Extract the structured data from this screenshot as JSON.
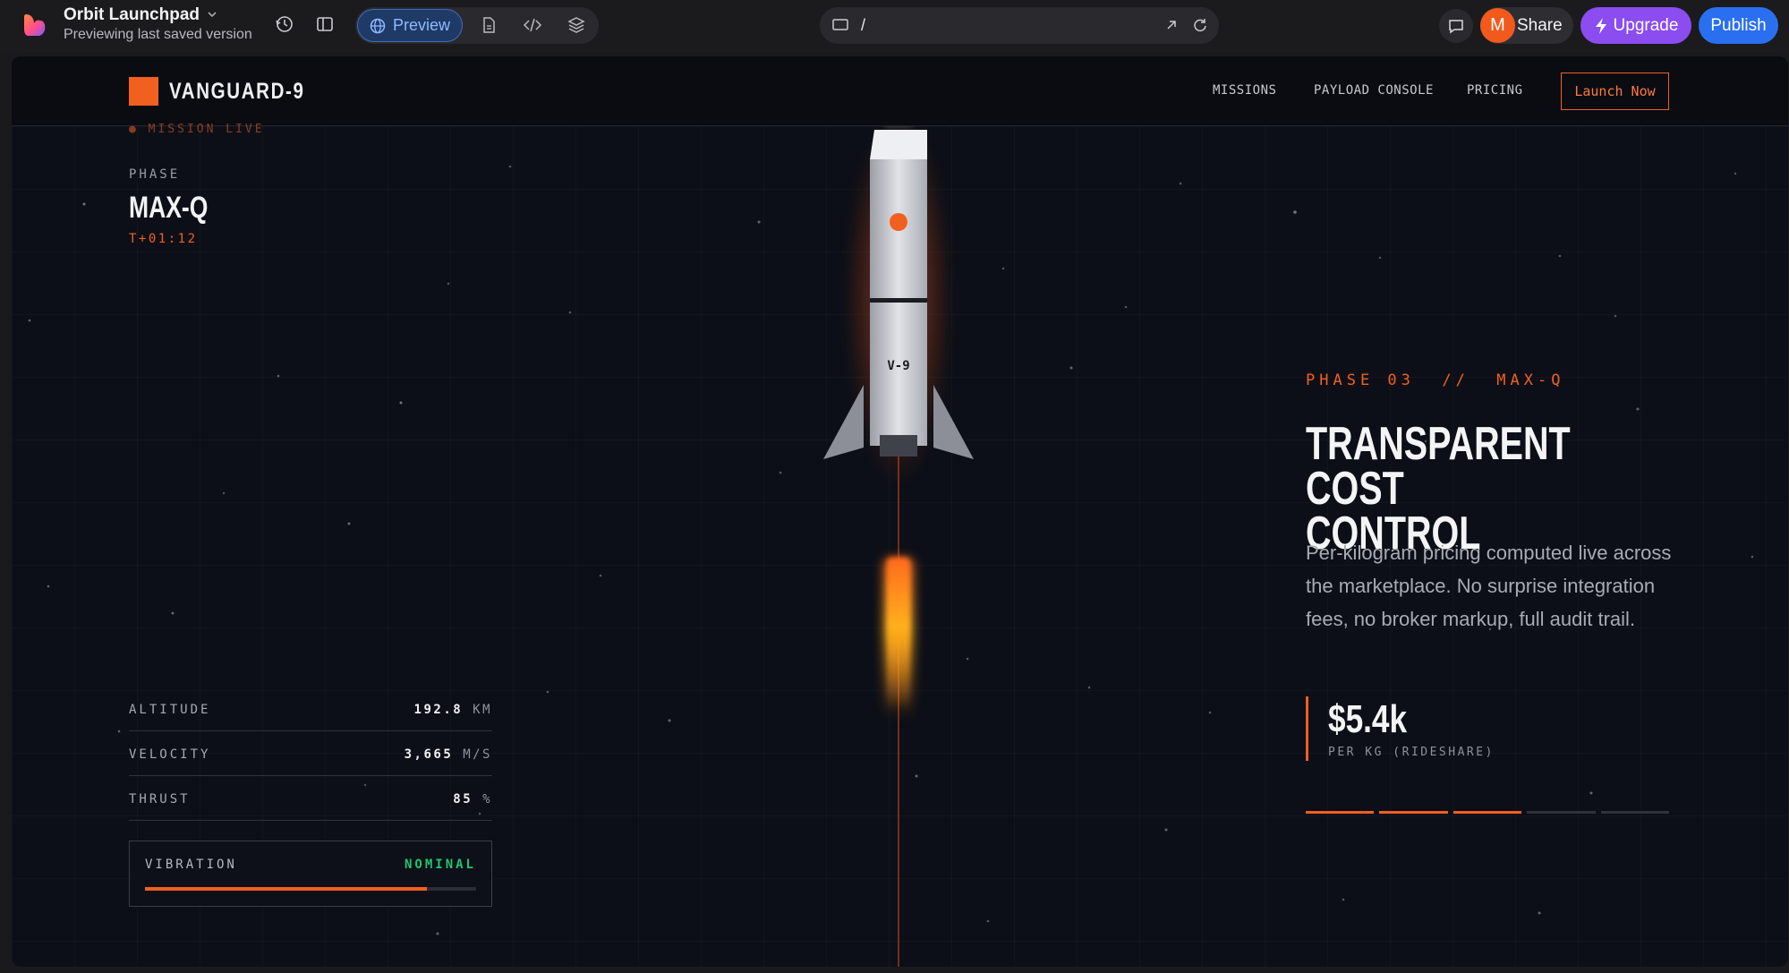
{
  "editor": {
    "app_name": "Orbit Launchpad",
    "app_subtitle": "Previewing last saved version",
    "preview_label": "Preview",
    "url_path": "/",
    "avatar_initial": "M",
    "share_label": "Share",
    "upgrade_label": "Upgrade",
    "publish_label": "Publish",
    "colors": {
      "preview_accent": "#8fbaff",
      "upgrade": "#8b4cf0",
      "publish": "#2a6ff0",
      "avatar": "#f25a1d"
    },
    "icons": [
      "app-logo-icon",
      "chevron-down-icon",
      "history-icon",
      "sidebar-toggle-icon",
      "globe-icon",
      "file-icon",
      "code-icon",
      "layers-icon",
      "monitor-icon",
      "open-external-icon",
      "refresh-icon",
      "chat-icon",
      "lightning-icon"
    ]
  },
  "site": {
    "brand": "VANGUARD-9",
    "nav": [
      "MISSIONS",
      "PAYLOAD CONSOLE",
      "PRICING"
    ],
    "cta": "Launch Now",
    "accent_color": "#f2601f",
    "status_line": "● MISSION LIVE",
    "phase_label": "PHASE",
    "phase_value": "MAX-Q",
    "phase_time": "T+01:12",
    "rocket_label": "V-9",
    "telemetry": [
      {
        "label": "ALTITUDE",
        "value": "192.8",
        "unit": "KM"
      },
      {
        "label": "VELOCITY",
        "value": "3,665",
        "unit": "M/S"
      },
      {
        "label": "THRUST",
        "value": "85",
        "unit": "%"
      }
    ],
    "vibration": {
      "label": "VIBRATION",
      "status": "NOMINAL",
      "level": 0.85,
      "status_color": "#1fc46d"
    },
    "feature": {
      "phase_heading": "PHASE 03  //  MAX-Q",
      "headline_line1": "TRANSPARENT COST",
      "headline_line2": "CONTROL",
      "body": "Per-kilogram pricing computed live across the marketplace. No surprise integration fees, no broker markup, full audit trail.",
      "price": "$5.4k",
      "price_unit": "PER KG (RIDESHARE)",
      "progress_total": 5,
      "progress_active": 3
    }
  }
}
